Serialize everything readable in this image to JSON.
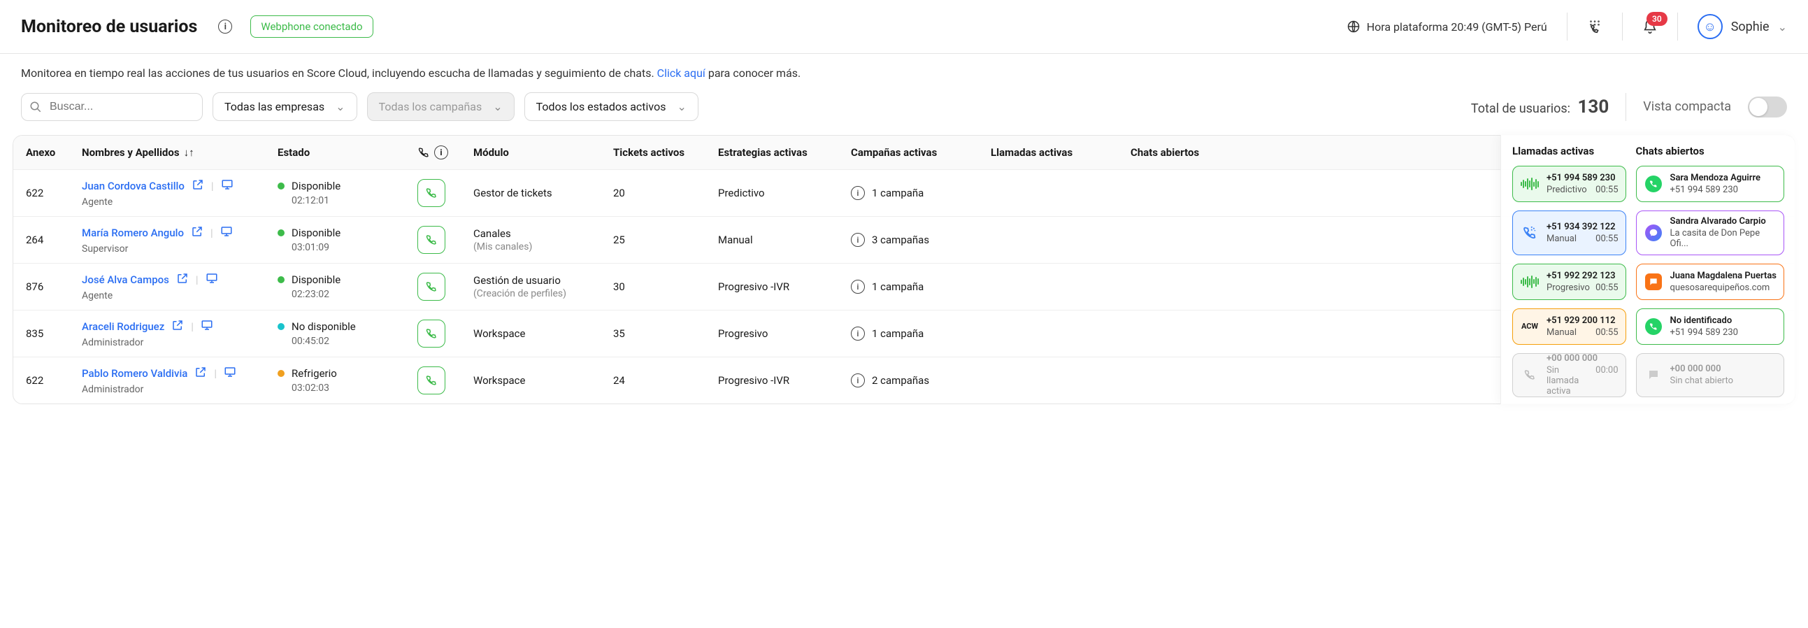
{
  "header": {
    "title": "Monitoreo de usuarios",
    "connected_badge": "Webphone conectado",
    "platform_time_label": "Hora plataforma 20:49 (GMT-5) Perú",
    "notif_count": "30",
    "user_name": "Sophie"
  },
  "description": {
    "text_a": "Monitorea en tiempo real las acciones de tus usuarios en Score Cloud, incluyendo escucha de llamadas y seguimiento de chats. ",
    "link": "Click aquí",
    "text_b": " para conocer más."
  },
  "filters": {
    "search_placeholder": "Buscar...",
    "companies": "Todas las empresas",
    "campaigns": "Todas los campañas",
    "states": "Todos los estados activos",
    "total_label": "Total de usuarios:",
    "total_value": "130",
    "compact_label": "Vista compacta"
  },
  "columns": {
    "c0": "Anexo",
    "c1": "Nombres y Apellidos",
    "c2": "Estado",
    "c4": "Módulo",
    "c5": "Tickets activos",
    "c6": "Estrategias activas",
    "c7": "Campañas activas",
    "c8": "Llamadas activas",
    "c9": "Chats abiertos"
  },
  "rows": [
    {
      "anexo": "622",
      "name": "Juan Cordova Castillo",
      "role": "Agente",
      "status": "Disponible",
      "status_color": "green",
      "time": "02:12:01",
      "module": "Gestor de tickets",
      "module_sub": "",
      "tickets": "20",
      "strategy": "Predictivo",
      "campaign": "1 campaña"
    },
    {
      "anexo": "264",
      "name": "María Romero Angulo",
      "role": "Supervisor",
      "status": "Disponible",
      "status_color": "green",
      "time": "03:01:09",
      "module": "Canales",
      "module_sub": "(Mis canales)",
      "tickets": "25",
      "strategy": "Manual",
      "campaign": "3 campañas"
    },
    {
      "anexo": "876",
      "name": "José  Alva Campos",
      "role": "Agente",
      "status": "Disponible",
      "status_color": "green",
      "time": "02:23:02",
      "module": "Gestión de usuario",
      "module_sub": "(Creación de perfiles)",
      "tickets": "30",
      "strategy": "Progresivo -IVR",
      "campaign": "1 campaña"
    },
    {
      "anexo": "835",
      "name": "Araceli Rodriguez",
      "role": "Administrador",
      "status": "No disponible",
      "status_color": "teal",
      "time": "00:45:02",
      "module": "Workspace",
      "module_sub": "",
      "tickets": "35",
      "strategy": "Progresivo",
      "campaign": "1 campaña"
    },
    {
      "anexo": "622",
      "name": "Pablo Romero Valdivia",
      "role": "Administrador",
      "status": "Refrigerio",
      "status_color": "orange",
      "time": "03:02:03",
      "module": "Workspace",
      "module_sub": "",
      "tickets": "24",
      "strategy": "Progresivo -IVR",
      "campaign": "2 campañas"
    }
  ],
  "side": {
    "calls_header": "Llamadas activas",
    "chats_header": "Chats abiertos",
    "calls": [
      {
        "l1": "+51 994 589 230",
        "l2a": "Predictivo",
        "l2b": "00:55",
        "style": "green-bg",
        "icon": "wave"
      },
      {
        "l1": "+51 934 392 122",
        "l2a": "Manual",
        "l2b": "00:55",
        "style": "blue",
        "icon": "phone-dotted"
      },
      {
        "l1": "+51 992 292 123",
        "l2a": "Progresivo",
        "l2b": "00:55",
        "style": "green-bg",
        "icon": "wave"
      },
      {
        "l1": "+51 929 200 112",
        "l2a": "Manual",
        "l2b": "00:55",
        "style": "amber",
        "icon": "acw"
      },
      {
        "l1": "+00 000 000",
        "l2a": "Sin llamada activa",
        "l2b": "00:00",
        "style": "gray",
        "icon": "phone-gray"
      }
    ],
    "chats": [
      {
        "l1": "Sara Mendoza Aguirre",
        "l2": "+51 994 589 230",
        "style": "green",
        "icon": "whatsapp"
      },
      {
        "l1": "Sandra Alvarado Carpio",
        "l2": "La casita de Don Pepe Ofi...",
        "style": "purple",
        "icon": "messenger"
      },
      {
        "l1": "Juana Magdalena Puertas",
        "l2": "quesosarequipeños.com",
        "style": "orange",
        "icon": "webchat"
      },
      {
        "l1": "No identificado",
        "l2": "+51 994 589 230",
        "style": "green",
        "icon": "whatsapp"
      },
      {
        "l1": "+00 000 000",
        "l2": "Sin chat abierto",
        "style": "gray",
        "icon": "chat-gray"
      }
    ]
  }
}
